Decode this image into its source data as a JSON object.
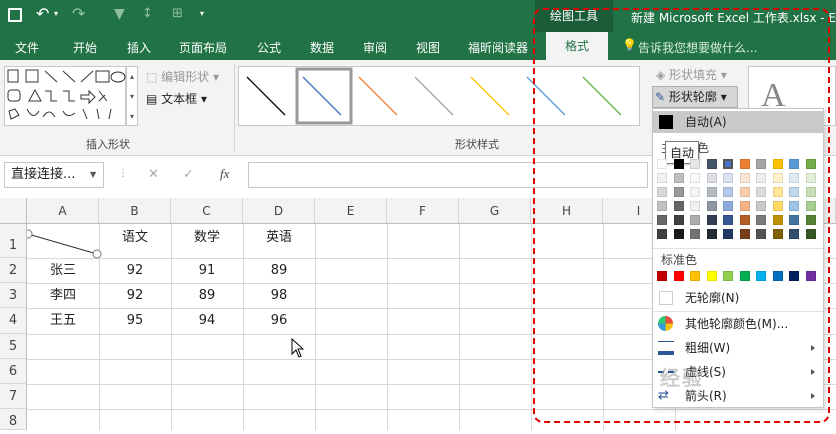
{
  "titlebar": {
    "drawing_tools": "绘图工具",
    "title": "新建 Microsoft Excel 工作表.xlsx - Ex"
  },
  "tabs": [
    "文件",
    "开始",
    "插入",
    "页面布局",
    "公式",
    "数据",
    "审阅",
    "视图",
    "福昕阅读器",
    "格式"
  ],
  "tell_me": "告诉我您想要做什么...",
  "ribbon": {
    "edit_shape": "编辑形状",
    "textbox": "文本框",
    "insert_shapes": "插入形状",
    "shape_styles": "形状样式",
    "shape_fill": "形状填充",
    "shape_outline": "形状轮廓"
  },
  "formula": {
    "name_box": "直接连接...",
    "fx": "fx",
    "cancel": "✕",
    "confirm": "✓"
  },
  "columns": [
    "A",
    "B",
    "C",
    "D",
    "E",
    "F",
    "G",
    "H",
    "I"
  ],
  "rows": [
    "1",
    "2",
    "3",
    "4",
    "5",
    "6",
    "7",
    "8"
  ],
  "table": [
    [
      "",
      "语文",
      "数学",
      "英语"
    ],
    [
      "张三",
      "92",
      "91",
      "89"
    ],
    [
      "李四",
      "92",
      "89",
      "98"
    ],
    [
      "王五",
      "95",
      "94",
      "96"
    ]
  ],
  "menu": {
    "auto": "自动(A)",
    "tooltip": "自动",
    "theme_colors": "主题颜色",
    "standard_colors": "标准色",
    "no_outline": "无轮廓(N)",
    "more_colors": "其他轮廓颜色(M)...",
    "weight": "粗细(W)",
    "dashes": "虚线(S)",
    "arrows": "箭头(R)"
  },
  "theme_top": [
    "#ffffff",
    "#000000",
    "#e7e6e6",
    "#44546a",
    "#4472c4",
    "#ed7d31",
    "#a5a5a5",
    "#ffc000",
    "#5b9bd5",
    "#70ad47"
  ],
  "standard": [
    "#c00000",
    "#ff0000",
    "#ffc000",
    "#ffff00",
    "#92d050",
    "#00b050",
    "#00b0f0",
    "#0070c0",
    "#002060",
    "#7030a0"
  ],
  "style_lines": [
    "#000000",
    "#4472c4",
    "#ed7d31",
    "#a5a5a5",
    "#ffc000",
    "#5b9bd5",
    "#70ad47"
  ],
  "watermark": "经验"
}
